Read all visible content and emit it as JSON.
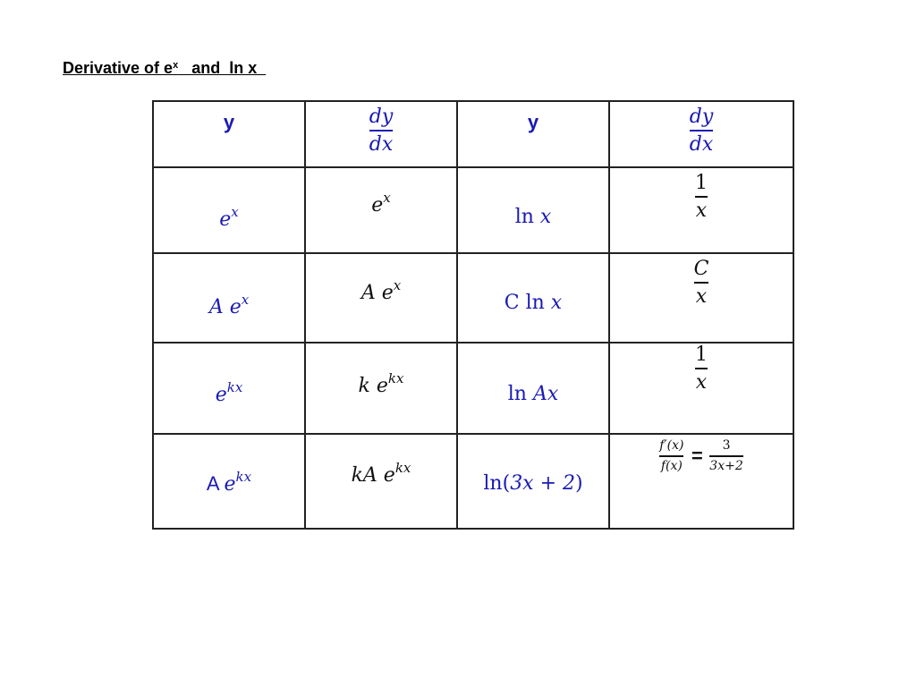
{
  "title": {
    "prefix": "Derivative of e",
    "sup": "x",
    "suffix": "   and  ln x  "
  },
  "colors": {
    "y_column": "#1a1ab3",
    "derivative_column": "#111111",
    "grid": "#222222"
  },
  "table": {
    "headers": [
      {
        "text": "y"
      },
      {
        "num": "dy",
        "den": "dx"
      },
      {
        "text": "y"
      },
      {
        "num": "dy",
        "den": "dx"
      }
    ],
    "rows": [
      {
        "exp_y": {
          "base": "e",
          "sup": "x"
        },
        "exp_dy": {
          "base": "e",
          "sup": "x"
        },
        "ln_y": {
          "fn": "ln ",
          "arg": "x"
        },
        "ln_dy": {
          "num": "1",
          "den": "x"
        }
      },
      {
        "exp_y": {
          "base": "A e",
          "sup": "x"
        },
        "exp_dy": {
          "base": "A e",
          "sup": "x"
        },
        "ln_y": {
          "fn": "C ln ",
          "arg": "x"
        },
        "ln_dy": {
          "num": "C",
          "den": "x"
        }
      },
      {
        "exp_y": {
          "base": "e",
          "sup": "kx"
        },
        "exp_dy": {
          "base": "k e",
          "sup": "kx"
        },
        "ln_y": {
          "fn": "ln ",
          "arg": "Ax"
        },
        "ln_dy": {
          "num": "1",
          "den": "x"
        }
      },
      {
        "exp_y": {
          "prefix": "A ",
          "base": "e",
          "sup": "kx"
        },
        "exp_dy": {
          "base": "kA e",
          "sup": "kx"
        },
        "ln_y": {
          "fn": "ln(",
          "arg": "3x + 2",
          "close": ")"
        },
        "ln_dy": {
          "lhs_num": "f′(x)",
          "lhs_den": "f(x)",
          "equals": "=",
          "rhs_num": "3",
          "rhs_den": "3x+2"
        }
      }
    ]
  }
}
